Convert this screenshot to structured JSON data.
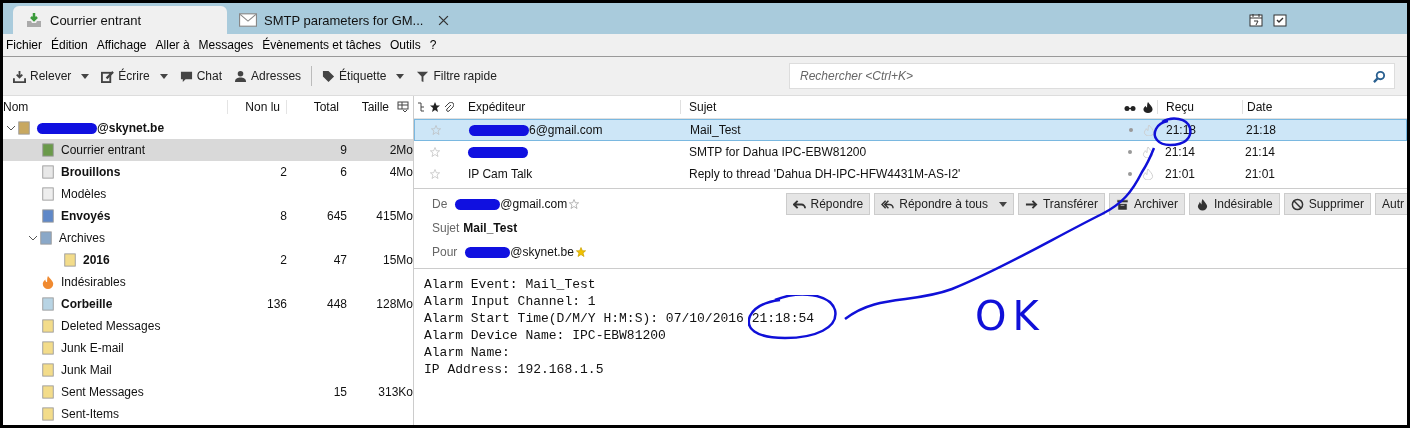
{
  "tabs": [
    {
      "label": "Courrier entrant",
      "selected": true,
      "kind": "inbox"
    },
    {
      "label": "SMTP parameters for GM...",
      "selected": false,
      "kind": "mail"
    }
  ],
  "menu": [
    "Fichier",
    "Édition",
    "Affichage",
    "Aller à",
    "Messages",
    "Évènements et tâches",
    "Outils",
    "?"
  ],
  "toolbar": [
    {
      "label": "Relever",
      "kind": "download",
      "dropdown": true
    },
    {
      "label": "Écrire",
      "kind": "pencil",
      "dropdown": true
    },
    {
      "label": "Chat",
      "kind": "chat",
      "dropdown": false
    },
    {
      "label": "Adresses",
      "kind": "person",
      "dropdown": false
    },
    {
      "label": "Étiquette",
      "kind": "tag",
      "dropdown": true
    },
    {
      "label": "Filtre rapide",
      "kind": "filter",
      "dropdown": false
    }
  ],
  "search": {
    "placeholder": "Rechercher <Ctrl+K>"
  },
  "folder_columns": [
    "Nom",
    "Non lu",
    "Total",
    "Taille"
  ],
  "folders": [
    {
      "name": "@skynet.be",
      "kind": "account",
      "expanded": true,
      "selected": false,
      "children": [
        {
          "name": "Courrier entrant",
          "kind": "inbox",
          "selected": true,
          "total": "9",
          "size": "2Mo"
        },
        {
          "name": "Brouillons",
          "kind": "drafts",
          "selected": false,
          "unread": "2",
          "total": "6",
          "size": "4Mo"
        },
        {
          "name": "Modèles",
          "kind": "templates",
          "selected": false
        },
        {
          "name": "Envoyés",
          "kind": "sent",
          "selected": false,
          "unread": "8",
          "total": "645",
          "size": "415Mo"
        },
        {
          "name": "Archives",
          "kind": "archive",
          "selected": false,
          "expanded": true,
          "children": [
            {
              "name": "2016",
              "kind": "folder",
              "selected": false,
              "unread": "2",
              "total": "47",
              "size": "15Mo"
            }
          ]
        },
        {
          "name": "Indésirables",
          "kind": "junk",
          "selected": false
        },
        {
          "name": "Corbeille",
          "kind": "trash",
          "selected": false,
          "unread": "136",
          "total": "448",
          "size": "128Mo"
        },
        {
          "name": "Deleted Messages",
          "kind": "folder",
          "selected": false
        },
        {
          "name": "Junk E-mail",
          "kind": "folder",
          "selected": false
        },
        {
          "name": "Junk Mail",
          "kind": "folder",
          "selected": false
        },
        {
          "name": "Sent Messages",
          "kind": "folder",
          "selected": false,
          "total": "15",
          "size": "313Ko"
        },
        {
          "name": "Sent-Items",
          "kind": "folder",
          "selected": false
        }
      ]
    }
  ],
  "message_columns": {
    "sender": "Expéditeur",
    "subject": "Sujet",
    "received": "Reçu",
    "date": "Date"
  },
  "messages": [
    {
      "sender": "6@gmail.com",
      "sender_redacted": true,
      "subject": "Mail_Test",
      "received": "21:18",
      "date": "21:18",
      "selected": true,
      "starred": false
    },
    {
      "sender_redacted": true,
      "subject": "SMTP for Dahua IPC-EBW81200",
      "received": "21:14",
      "date": "21:14",
      "selected": false,
      "starred": false
    },
    {
      "sender": "IP Cam Talk",
      "sender_redacted": false,
      "subject": "Reply to thread 'Dahua DH-IPC-HFW4431M-AS-I2'",
      "received": "21:01",
      "date": "21:01",
      "selected": false,
      "starred": false
    }
  ],
  "header": {
    "from_label": "De",
    "from": "@gmail.com",
    "subject_label": "Sujet",
    "subject": "Mail_Test",
    "to_label": "Pour",
    "to": "@skynet.be"
  },
  "actions": [
    {
      "label": "Répondre",
      "kind": "reply",
      "dropdown": false
    },
    {
      "label": "Répondre à tous",
      "kind": "reply-all",
      "dropdown": true
    },
    {
      "label": "Transférer",
      "kind": "forward",
      "dropdown": false
    },
    {
      "label": "Archiver",
      "kind": "archive",
      "dropdown": false
    },
    {
      "label": "Indésirable",
      "kind": "junk",
      "dropdown": false
    },
    {
      "label": "Supprimer",
      "kind": "delete",
      "dropdown": false
    },
    {
      "label": "Autr",
      "kind": "none",
      "dropdown": false
    }
  ],
  "body": [
    "Alarm Event: Mail_Test",
    "Alarm Input Channel: 1",
    "Alarm Start Time(D/M/Y H:M:S): 07/10/2016 21:18:54",
    "Alarm Device Name: IPC-EBW81200",
    "Alarm Name:",
    "IP Address: 192.168.1.5"
  ],
  "annotation": {
    "text": "OK"
  }
}
